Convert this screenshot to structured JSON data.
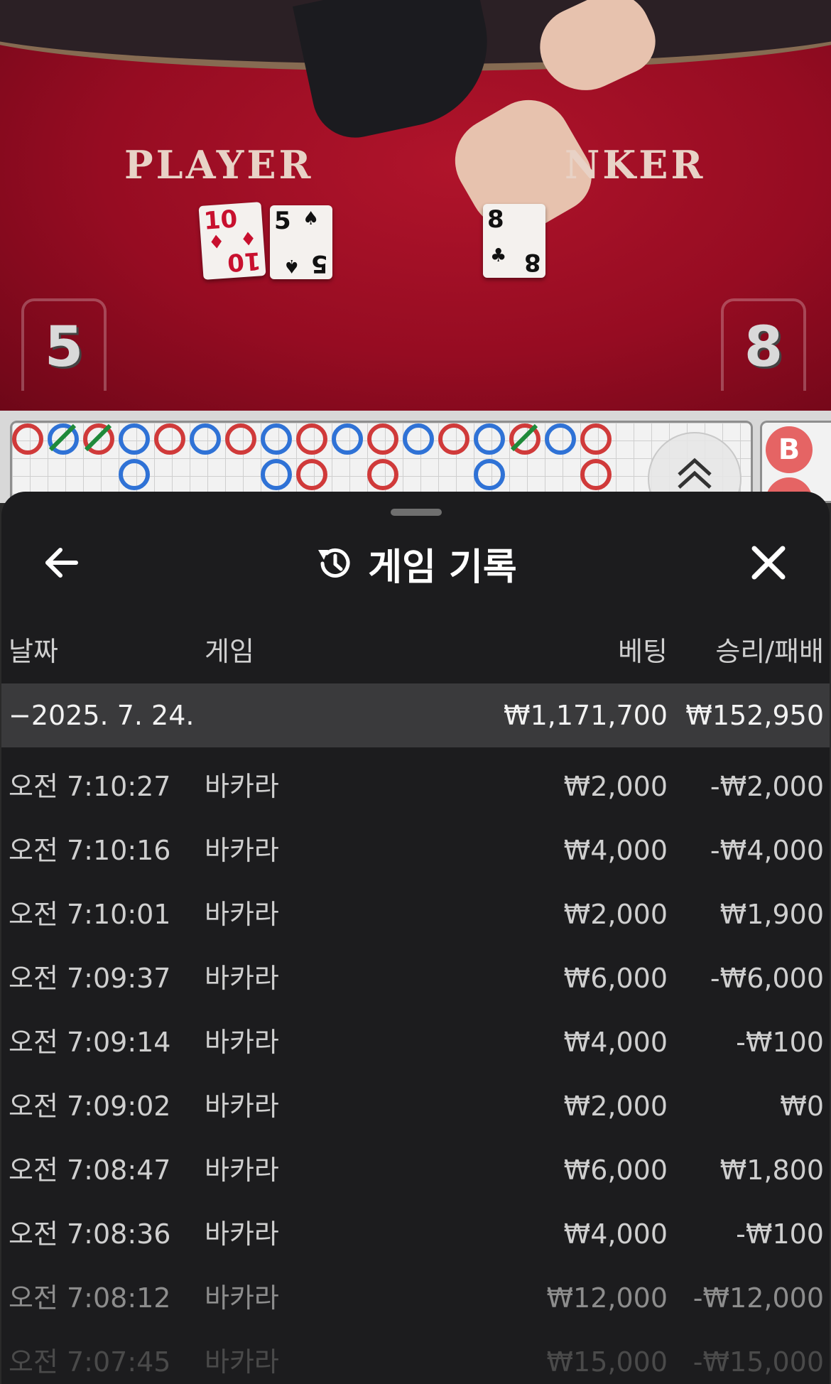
{
  "video": {
    "player_label": "PLAYER",
    "banker_label": "NKER",
    "player_score": "5",
    "banker_score": "8",
    "player_cards": [
      {
        "rank": "10",
        "suit": "♦",
        "color": "red"
      },
      {
        "rank": "5",
        "suit": "♠",
        "color": "black"
      }
    ],
    "banker_cards": [
      {
        "rank": "8",
        "suit": "♣",
        "color": "black"
      }
    ]
  },
  "roadmap": {
    "side_badge": "B",
    "collapse_icon": "double-chevron-up-icon",
    "colors": {
      "banker": "#d03a3a",
      "player": "#2f72d6",
      "tie": "#1f8a3a"
    }
  },
  "sheet": {
    "title": "게임 기록",
    "title_icon": "history-icon",
    "back_icon": "arrow-left-icon",
    "close_icon": "close-icon",
    "columns": {
      "date": "날짜",
      "game": "게임",
      "bet": "베팅",
      "win_loss": "승리/패배"
    },
    "day": {
      "label": "−2025. 7. 24.",
      "bet_total": "₩1,171,700",
      "win_total": "₩152,950"
    },
    "rows": [
      {
        "time": "오전 7:10:27",
        "game": "바카라",
        "bet": "₩2,000",
        "result": "-₩2,000"
      },
      {
        "time": "오전 7:10:16",
        "game": "바카라",
        "bet": "₩4,000",
        "result": "-₩4,000"
      },
      {
        "time": "오전 7:10:01",
        "game": "바카라",
        "bet": "₩2,000",
        "result": "₩1,900"
      },
      {
        "time": "오전 7:09:37",
        "game": "바카라",
        "bet": "₩6,000",
        "result": "-₩6,000"
      },
      {
        "time": "오전 7:09:14",
        "game": "바카라",
        "bet": "₩4,000",
        "result": "-₩100"
      },
      {
        "time": "오전 7:09:02",
        "game": "바카라",
        "bet": "₩2,000",
        "result": "₩0"
      },
      {
        "time": "오전 7:08:47",
        "game": "바카라",
        "bet": "₩6,000",
        "result": "₩1,800"
      },
      {
        "time": "오전 7:08:36",
        "game": "바카라",
        "bet": "₩4,000",
        "result": "-₩100"
      },
      {
        "time": "오전 7:08:12",
        "game": "바카라",
        "bet": "₩12,000",
        "result": "-₩12,000"
      },
      {
        "time": "오전 7:07:45",
        "game": "바카라",
        "bet": "₩15,000",
        "result": "-₩15,000"
      }
    ]
  }
}
